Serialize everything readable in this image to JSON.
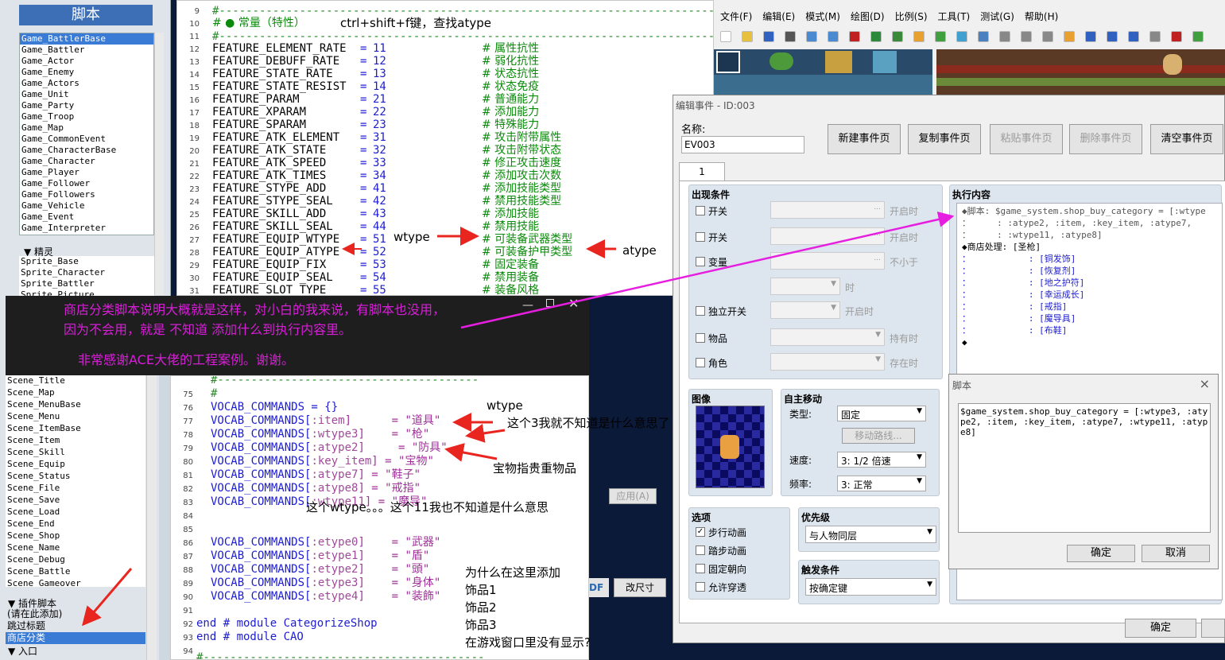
{
  "left_panel": {
    "title": "脚本",
    "top_list": [
      "Game_BattlerBase",
      "Game_Battler",
      "Game_Actor",
      "Game_Enemy",
      "Game_Actors",
      "Game_Unit",
      "Game_Party",
      "Game_Troop",
      "Game_Map",
      "Game_CommonEvent",
      "Game_CharacterBase",
      "Game_Character",
      "Game_Player",
      "Game_Follower",
      "Game_Followers",
      "Game_Vehicle",
      "Game_Event",
      "Game_Interpreter"
    ],
    "sprite_header": "▼ 精灵",
    "sprite_list": [
      "Sprite_Base",
      "Sprite_Character",
      "Sprite_Battler",
      "Sprite_Picture"
    ],
    "scene_list": [
      "Scene_Title",
      "Scene_Map",
      "Scene_MenuBase",
      "Scene_Menu",
      "Scene_ItemBase",
      "Scene_Item",
      "Scene_Skill",
      "Scene_Equip",
      "Scene_Status",
      "Scene_File",
      "Scene_Save",
      "Scene_Load",
      "Scene_End",
      "Scene_Shop",
      "Scene_Name",
      "Scene_Debug",
      "Scene_Battle",
      "Scene_Gameover"
    ],
    "plugin_header": "▼ 插件脚本",
    "plugin_items": [
      "(请在此添加)",
      "跳过标题",
      "商店分类"
    ],
    "entry_header": "▼ 入口"
  },
  "code_top": {
    "line_numbers": [
      "9",
      "10",
      "11",
      "12",
      "13",
      "14",
      "15",
      "16",
      "17",
      "18",
      "19",
      "20",
      "21",
      "22",
      "23",
      "24",
      "25",
      "26",
      "27",
      "28",
      "29",
      "30",
      "31"
    ],
    "header_comment": "# ● 常量（特性）",
    "hint": "ctrl+shift+f键，查找atype",
    "rows": [
      {
        "name": "FEATURE_ELEMENT_RATE",
        "val": "11",
        "cmt": "# 属性抗性"
      },
      {
        "name": "FEATURE_DEBUFF_RATE",
        "val": "12",
        "cmt": "# 弱化抗性"
      },
      {
        "name": "FEATURE_STATE_RATE",
        "val": "13",
        "cmt": "# 状态抗性"
      },
      {
        "name": "FEATURE_STATE_RESIST",
        "val": "14",
        "cmt": "# 状态免疫"
      },
      {
        "name": "FEATURE_PARAM",
        "val": "21",
        "cmt": "# 普通能力"
      },
      {
        "name": "FEATURE_XPARAM",
        "val": "22",
        "cmt": "# 添加能力"
      },
      {
        "name": "FEATURE_SPARAM",
        "val": "23",
        "cmt": "# 特殊能力"
      },
      {
        "name": "FEATURE_ATK_ELEMENT",
        "val": "31",
        "cmt": "# 攻击附带属性"
      },
      {
        "name": "FEATURE_ATK_STATE",
        "val": "32",
        "cmt": "# 攻击附带状态"
      },
      {
        "name": "FEATURE_ATK_SPEED",
        "val": "33",
        "cmt": "# 修正攻击速度"
      },
      {
        "name": "FEATURE_ATK_TIMES",
        "val": "34",
        "cmt": "# 添加攻击次数"
      },
      {
        "name": "FEATURE_STYPE_ADD",
        "val": "41",
        "cmt": "# 添加技能类型"
      },
      {
        "name": "FEATURE_STYPE_SEAL",
        "val": "42",
        "cmt": "# 禁用技能类型"
      },
      {
        "name": "FEATURE_SKILL_ADD",
        "val": "43",
        "cmt": "# 添加技能"
      },
      {
        "name": "FEATURE_SKILL_SEAL",
        "val": "44",
        "cmt": "# 禁用技能"
      },
      {
        "name": "FEATURE_EQUIP_WTYPE",
        "val": "51",
        "cmt": "# 可装备武器类型"
      },
      {
        "name": "FEATURE_EQUIP_ATYPE",
        "val": "52",
        "cmt": "# 可装备护甲类型"
      },
      {
        "name": "FEATURE_EQUIP_FIX",
        "val": "53",
        "cmt": "# 固定装备"
      },
      {
        "name": "FEATURE_EQUIP_SEAL",
        "val": "54",
        "cmt": "# 禁用装备"
      },
      {
        "name": "FEATURE_SLOT_TYPE",
        "val": "55",
        "cmt": "# 装备风格"
      }
    ],
    "wtype_note": "wtype",
    "atype_note": "atype"
  },
  "dark_note": {
    "line1": "商店分类脚本说明大概就是这样，对小白的我来说，有脚本也没用，",
    "line2": "因为不会用，就是  不知道  添加什么到执行内容里。",
    "line3": "非常感谢ACE大佬的工程案例。谢谢。"
  },
  "code_bottom": {
    "line_numbers": [
      "75",
      "76",
      "77",
      "78",
      "79",
      "80",
      "81",
      "82",
      "83",
      "84",
      "85",
      "86",
      "87",
      "88",
      "89",
      "90",
      "91",
      "92",
      "93",
      "94",
      "95"
    ],
    "lines": [
      {
        "a": "#",
        "b": "",
        "c": ""
      },
      {
        "a": "VOCAB_COMMANDS = {}",
        "b": "",
        "c": ""
      },
      {
        "a": "VOCAB_COMMANDS[",
        "b": ":item",
        "c": "]      = \"道具\""
      },
      {
        "a": "VOCAB_COMMANDS[",
        "b": ":wtype3",
        "c": "]    = \"枪\""
      },
      {
        "a": "VOCAB_COMMANDS[",
        "b": ":atype2",
        "c": "]     = \"防具\""
      },
      {
        "a": "VOCAB_COMMANDS[",
        "b": ":key_item",
        "c": "] = \"宝物\""
      },
      {
        "a": "VOCAB_COMMANDS[",
        "b": ":atype7",
        "c": "] = \"鞋子\""
      },
      {
        "a": "VOCAB_COMMANDS[",
        "b": ":atype8",
        "c": "] = \"戒指\""
      },
      {
        "a": "VOCAB_COMMANDS[",
        "b": ":wtype11",
        "c": "] = \"魔导\""
      },
      {
        "a": "",
        "b": "",
        "c": ""
      },
      {
        "a": "",
        "b": "",
        "c": ""
      },
      {
        "a": "VOCAB_COMMANDS[",
        "b": ":etype0",
        "c": "]    = \"武器\""
      },
      {
        "a": "VOCAB_COMMANDS[",
        "b": ":etype1",
        "c": "]    = \"盾\""
      },
      {
        "a": "VOCAB_COMMANDS[",
        "b": ":etype2",
        "c": "]    = \"頭\""
      },
      {
        "a": "VOCAB_COMMANDS[",
        "b": ":etype3",
        "c": "]    = \"身体\""
      },
      {
        "a": "VOCAB_COMMANDS[",
        "b": ":etype4",
        "c": "]    = \"装飾\""
      },
      {
        "a": "",
        "b": "",
        "c": ""
      },
      {
        "a": "end # module CategorizeShop",
        "b": "",
        "c": ""
      },
      {
        "a": "end # module CAO",
        "b": "",
        "c": ""
      },
      {
        "a": "",
        "b": "",
        "c": ""
      },
      {
        "a": "",
        "b": "",
        "c": ""
      }
    ],
    "note_wtype": "wtype",
    "note_3": "这个3我就不知道是什么意思了",
    "note_treasure": "宝物指贵重物品",
    "note_11": "这个wtype。。。这个11我也不知道是什么意思",
    "note_why": "为什么在这里添加",
    "note_acc1": "饰品1",
    "note_acc2": "饰品2",
    "note_acc3": "饰品3",
    "note_notshown": "在游戏窗口里没有显示?",
    "apply_btn": "应用(A)",
    "pdf_btn": "DF",
    "resize_btn": "改尺寸"
  },
  "rm_menu": [
    "文件(F)",
    "编辑(E)",
    "模式(M)",
    "绘图(D)",
    "比例(S)",
    "工具(T)",
    "测试(G)",
    "帮助(H)"
  ],
  "event_editor": {
    "title": "编辑事件 - ID:003",
    "name_label": "名称:",
    "name_value": "EV003",
    "buttons": [
      "新建事件页",
      "复制事件页",
      "粘贴事件页",
      "删除事件页",
      "清空事件页"
    ],
    "tab": "1",
    "conditions_label": "出现条件",
    "conditions": [
      {
        "label": "开关",
        "suffix": "开启时"
      },
      {
        "label": "开关",
        "suffix": "开启时"
      },
      {
        "label": "变量",
        "suffix": "不小于"
      },
      {
        "label": "",
        "suffix": "时"
      },
      {
        "label": "独立开关",
        "suffix": "开启时"
      },
      {
        "label": "物品",
        "suffix": "持有时"
      },
      {
        "label": "角色",
        "suffix": "存在时"
      }
    ],
    "image_label": "图像",
    "automove_label": "自主移动",
    "type_label": "类型:",
    "type_value": "固定",
    "route_btn": "移动路线...",
    "speed_label": "速度:",
    "speed_value": "3: 1/2 倍速",
    "freq_label": "频率:",
    "freq_value": "3: 正常",
    "options_label": "选项",
    "options": [
      {
        "label": "步行动画",
        "checked": true
      },
      {
        "label": "踏步动画",
        "checked": false
      },
      {
        "label": "固定朝向",
        "checked": false
      },
      {
        "label": "允许穿透",
        "checked": false
      }
    ],
    "priority_label": "优先级",
    "priority_value": "与人物同层",
    "trigger_label": "触发条件",
    "trigger_value": "按确定键",
    "content_label": "执行内容",
    "content_lines": [
      "◆脚本: $game_system.shop_buy_category = [:wtype",
      "：     : :atype2, :item, :key_item, :atype7,",
      "：     : :wtype11, :atype8]",
      "◆商店处理: [圣枪]",
      "：           : [铜发饰]",
      "：           : [恢复剂]",
      "：           : [地之护符]",
      "：           : [幸运成长]",
      "：           : [戒指]",
      "：           : [魔导具]",
      "：           : [布鞋]",
      "◆"
    ],
    "ok": "确定"
  },
  "script_dialog": {
    "title": "脚本",
    "close": "×",
    "text": "$game_system.shop_buy_category = [:wtype3, :atype2, :item, :key_item, :atype7, :wtype11, :atype8]",
    "ok": "确定",
    "cancel": "取消"
  },
  "colors": {
    "arrow_red": "#e8251f",
    "arrow_magenta": "#e61ee0",
    "note_magenta": "#d81fd8"
  }
}
